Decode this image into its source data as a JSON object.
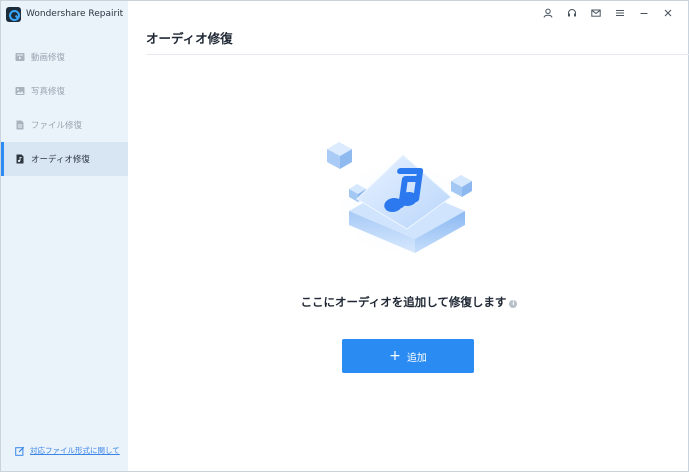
{
  "app": {
    "title": "Wondershare Repairit"
  },
  "sidebar": {
    "items": [
      {
        "label": "動画修復",
        "icon": "video-icon",
        "active": false
      },
      {
        "label": "写真修復",
        "icon": "image-icon",
        "active": false
      },
      {
        "label": "ファイル修復",
        "icon": "file-icon",
        "active": false
      },
      {
        "label": "オーディオ修復",
        "icon": "audio-file-icon",
        "active": true
      }
    ],
    "footer_link": "対応ファイル形式に関して"
  },
  "window_controls": [
    "user-icon",
    "headset-icon",
    "mail-icon",
    "menu-icon",
    "minimize-icon",
    "close-icon"
  ],
  "main": {
    "title": "オーディオ修復",
    "prompt": "ここにオーディオを追加して修復します",
    "info_glyph": "i",
    "add_button": {
      "plus": "+",
      "label": "追加"
    }
  },
  "colors": {
    "accent": "#2a8bf2",
    "sidebar_bg": "#eaf2fa",
    "active_bg": "#d8e6f4"
  }
}
